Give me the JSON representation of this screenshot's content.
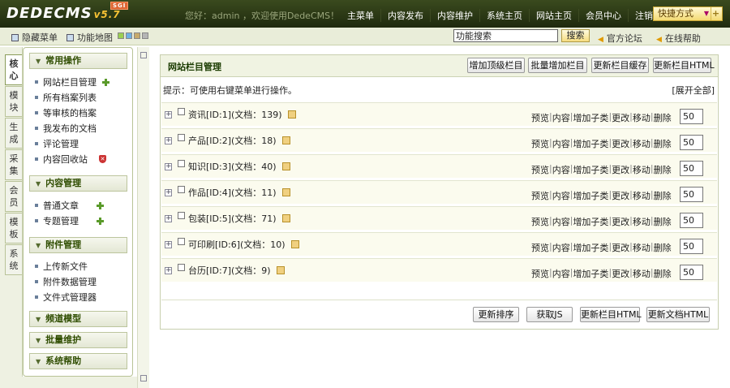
{
  "app": {
    "logo": "DEDECMS",
    "version": "v5.7",
    "edition": "SGI"
  },
  "topbar": {
    "welcome": "您好：admin ，欢迎使用DedeCMS！",
    "nav": [
      "主菜单",
      "内容发布",
      "内容维护",
      "系统主页",
      "网站主页",
      "会员中心",
      "注销"
    ],
    "quick_label": "快捷方式",
    "quick_arrow": "▼",
    "quick_plus": "+"
  },
  "subbar": {
    "hide_menu": "隐藏菜单",
    "func_map": "功能地图",
    "swatches": [
      "#9bcf52",
      "#6fb0e3",
      "#c6a96b",
      "#b5b5b5"
    ],
    "search_value": "功能搜索",
    "search_button": "搜索",
    "forum": "官方论坛",
    "help": "在线帮助"
  },
  "lefttabs": [
    "核心",
    "模块",
    "生成",
    "采集",
    "会员",
    "模板",
    "系统"
  ],
  "sidebar": {
    "groups": [
      {
        "title": "常用操作",
        "items": [
          {
            "label": "网站栏目管理",
            "icon": "add-icon"
          },
          {
            "label": "所有档案列表"
          },
          {
            "label": "等审核的档案"
          },
          {
            "label": "我发布的文档"
          },
          {
            "label": "评论管理"
          },
          {
            "label": "内容回收站",
            "icon": "recycle-icon"
          }
        ]
      },
      {
        "title": "内容管理",
        "items": [
          {
            "label": "普通文章",
            "icon": "add-icon"
          },
          {
            "label": "专题管理",
            "icon": "add-icon"
          }
        ]
      },
      {
        "title": "附件管理",
        "items": [
          {
            "label": "上传新文件"
          },
          {
            "label": "附件数据管理"
          },
          {
            "label": "文件式管理器"
          }
        ]
      },
      {
        "title": "频道模型",
        "items": []
      },
      {
        "title": "批量维护",
        "items": []
      },
      {
        "title": "系统帮助",
        "items": []
      }
    ]
  },
  "main": {
    "title": "网站栏目管理",
    "buttons": [
      "增加顶级栏目",
      "批量增加栏目",
      "更新栏目缓存",
      "更新栏目HTML"
    ],
    "hint": "提示：可使用右键菜单进行操作。",
    "expand_all": "[展开全部]",
    "expand_symbol": "+",
    "rows": [
      {
        "name": "资讯[ID:1](文档：139)",
        "order": "50"
      },
      {
        "name": "产品[ID:2](文档：18)",
        "order": "50"
      },
      {
        "name": "知识[ID:3](文档：40)",
        "order": "50"
      },
      {
        "name": "作品[ID:4](文档：11)",
        "order": "50"
      },
      {
        "name": "包装[ID:5](文档：71)",
        "order": "50"
      },
      {
        "name": "可印刷[ID:6](文档：10)",
        "order": "50"
      },
      {
        "name": "台历[ID:7](文档：9)",
        "order": "50"
      }
    ],
    "ops": [
      "预览",
      "内容",
      "增加子类",
      "更改",
      "移动",
      "删除"
    ],
    "footer_buttons": [
      "更新排序",
      "获取JS",
      "更新栏目HTML",
      "更新文档HTML"
    ]
  }
}
